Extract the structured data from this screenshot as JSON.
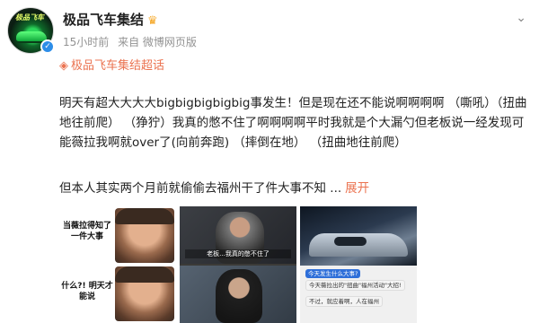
{
  "post": {
    "author": "极品飞车集结",
    "time": "15小时前",
    "source": "来自 微博网页版",
    "topic": "极品飞车集结超话",
    "avatar_text": "极品飞车",
    "body": "明天有超大大大大bigbigbigbigbig事发生！但是现在还不能说啊啊啊啊 （嘶吼）（扭曲地往前爬） （狰狞）我真的憋不住了啊啊啊啊平时我就是个大漏勺但老板说一经发现可能薇拉我啊就over了(向前奔跑) （摔倒在地） （扭曲地往前爬）",
    "body2": "但本人其实两个月前就偷偷去福州干了件大事不知 ...",
    "expand_label": "展开"
  },
  "images": {
    "meme1": {
      "caption_top": "当薇拉得知了一件大事",
      "caption_bottom": "什么?! 明天才能说"
    },
    "meme2": {
      "subtitle": "老板...我真的憋不住了"
    },
    "meme3": {
      "msg1": "今天发生什么大事?",
      "msg2": "今天薇拉出的\"扭曲\"福州活动\"大招!",
      "msg3": "不过，就应着啊，人在福州"
    }
  },
  "icons": {
    "verified": "verified-badge-icon",
    "crown": "crown-icon",
    "topic": "diamond-topic-icon",
    "more": "chevron-down-icon"
  },
  "colors": {
    "accent": "#eb7350",
    "meta_gray": "#939393",
    "verified_blue": "#2c8de8"
  }
}
